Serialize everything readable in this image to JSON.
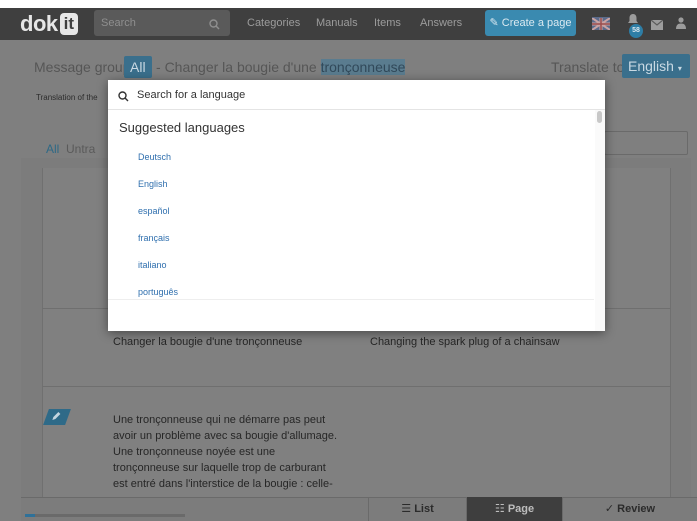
{
  "app": {
    "logo_text": "dok",
    "logo_mark": "it"
  },
  "nav": {
    "search_placeholder": "Search",
    "links": [
      "Categories",
      "Manuals",
      "Items",
      "Answers"
    ],
    "create_label": "Create a page",
    "notification_count": "58"
  },
  "header": {
    "message_group_label": "Message group",
    "group_value": "All",
    "separator": "-",
    "page_prefix": "Changer la bougie d'une",
    "page_highlight": "tronçonneuse",
    "translate_to_label": "Translate to",
    "target_language": "English"
  },
  "subheader": {
    "translation_of": "Translation of the"
  },
  "tabs": {
    "all": "All",
    "untranslated": "Untra"
  },
  "rows": [
    {
      "source": "Changer la bougie d'une tronçonneuse",
      "target": "Changing the spark plug of a chainsaw"
    },
    {
      "source": "Une tronçonneuse qui ne démarre pas peut avoir un problème avec sa bougie d'allumage. Une tronçonneuse noyée est une tronçonneuse sur laquelle trop de carburant est entré dans l'interstice de la bougie : celle-",
      "target": ""
    }
  ],
  "bottom": {
    "view_list": "List",
    "view_page": "Page",
    "view_review": "Review",
    "progress": 0.06
  },
  "language_picker": {
    "search_placeholder": "Search for a language",
    "section_title": "Suggested languages",
    "languages": [
      "Deutsch",
      "English",
      "español",
      "français",
      "italiano",
      "português"
    ]
  },
  "colors": {
    "accent": "#3a8ab0",
    "link": "#2f6fae",
    "topbar": "#3f3f3f"
  }
}
